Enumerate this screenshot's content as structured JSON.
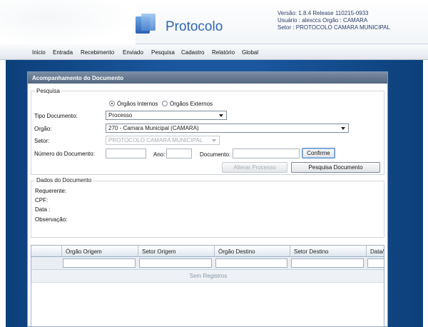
{
  "header": {
    "logo_text": "Protocolo",
    "version": "Versão: 1.8.4 Release 110215-0933",
    "user": "Usuário : alexccs  Orgão : CAMARA",
    "sector": "Setor : PROTOCOLO CAMARA MUNICIPAL"
  },
  "menu": [
    "Inicio",
    "Entrada",
    "Recebimento",
    "Enviado",
    "Pesquisa",
    "Cadastro",
    "Relatório",
    "Global"
  ],
  "panel": {
    "title": "Acompanhamento do Documento",
    "search_legend": "Pesquisa",
    "radio_internal": "Órgãos Internos",
    "radio_external": "Órgãos Externos",
    "tipo_label": "Tipo Documento:",
    "tipo_value": "Processo",
    "orgao_label": "Orgão:",
    "orgao_value": "270 - Camara Municipal (CAMARA)",
    "setor_label": "Setor:",
    "setor_value": "PROTOCOLO CAMARA MUNICIPAL",
    "numero_label": "Número do Documento:",
    "ano_label": "Ano:",
    "documento_label": "Documento:",
    "confirm_button": "Confirme",
    "alter_button": "Alterar Processo",
    "search_button": "Pesquisa Documento",
    "data_legend": "Dados do Documento",
    "requerente_label": "Requerente:",
    "cpf_label": "CPF:",
    "data_label": "Data :",
    "obs_label": "Observação:"
  },
  "grid": {
    "columns": [
      "",
      "Órgão Origem",
      "Setor Origem",
      "Órgão Destino",
      "Setor Destino",
      "Data/H"
    ],
    "empty_text": "Sem Registros"
  },
  "colors": {
    "accent_blue": "#1a579e",
    "panel_title": "#55677f",
    "logo_blue": "#2e66b5"
  }
}
